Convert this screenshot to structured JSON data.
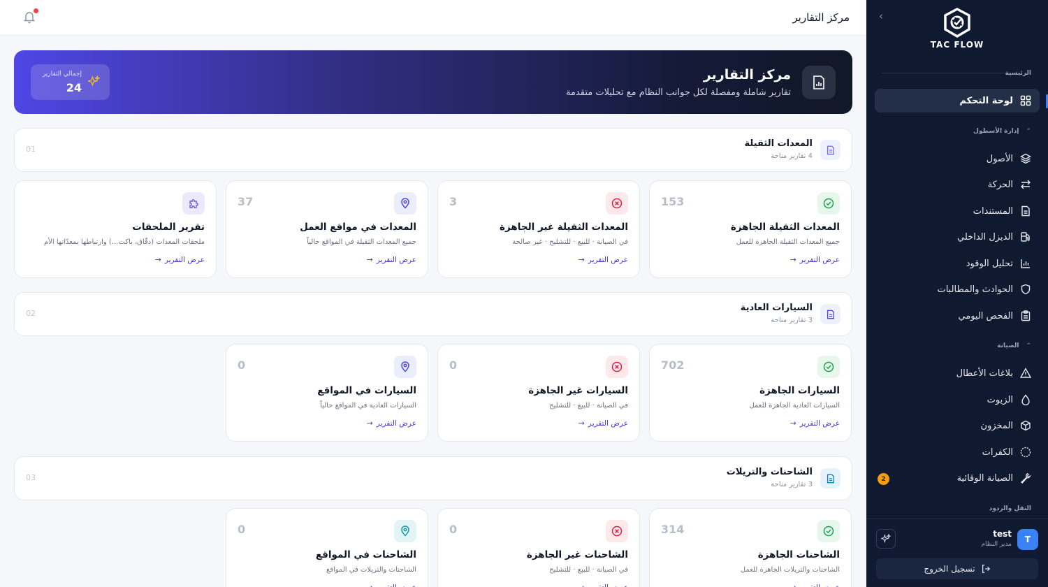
{
  "sidebar": {
    "brand": "TAC FLOW",
    "sections": {
      "main": "الرئيسية",
      "fleet": "إدارة الأسطول",
      "maintenance": "الصيانة",
      "transport": "النقل والردود"
    },
    "items": {
      "dashboard": "لوحة التحكم",
      "assets": "الأصول",
      "movement": "الحركة",
      "documents": "المستندات",
      "internal_diesel": "الديزل الداخلي",
      "fuel_analysis": "تحليل الوقود",
      "incidents": "الحوادث والمطالبات",
      "daily_inspection": "الفحص اليومي",
      "fault_reports": "بلاغات الأعطال",
      "oils": "الزيوت",
      "inventory": "المخزون",
      "tires": "الكفرات",
      "preventive": "الصيانة الوقائية"
    },
    "preventive_badge": "2",
    "user": {
      "initial": "T",
      "name": "test",
      "role": "مدير النظام"
    },
    "logout": "تسجيل الخروج"
  },
  "topbar": {
    "title": "مركز التقارير"
  },
  "hero": {
    "title": "مركز التقارير",
    "subtitle": "تقارير شاملة ومفصلة لكل جوانب النظام مع تحليلات متقدمة",
    "total_label": "إجمالي التقارير",
    "total_value": "24"
  },
  "link_label": "عرض التقرير",
  "sections": [
    {
      "title": "المعدات الثقيلة",
      "subtitle": "4 تقارير متاحة",
      "num": "01",
      "cards": [
        {
          "title": "المعدات الثقيلة الجاهزة",
          "desc": "جميع المعدات الثقيلة الجاهزة للعمل",
          "count": "153",
          "icon": "check-circle-icon"
        },
        {
          "title": "المعدات الثقيلة غير الجاهزة",
          "desc": "في الصيانة · للبيع · للتشليح · غير صالحة",
          "count": "3",
          "icon": "x-circle-icon"
        },
        {
          "title": "المعدات في مواقع العمل",
          "desc": "جميع المعدات الثقيلة في المواقع حالياً",
          "count": "37",
          "icon": "map-pin-icon"
        },
        {
          "title": "تقرير الملحقات",
          "desc": "ملحقات المعدات (دقّاق، باكت...) وارتباطها بمعدّاتها الأم",
          "count": "",
          "icon": "puzzle-icon"
        }
      ]
    },
    {
      "title": "السيارات العادية",
      "subtitle": "3 تقارير متاحة",
      "num": "02",
      "cards": [
        {
          "title": "السيارات الجاهزة",
          "desc": "السيارات العادية الجاهزة للعمل",
          "count": "702",
          "icon": "check-circle-icon"
        },
        {
          "title": "السيارات غير الجاهزة",
          "desc": "في الصيانة · للبيع · للتشليح",
          "count": "0",
          "icon": "x-circle-icon"
        },
        {
          "title": "السيارات في المواقع",
          "desc": "السيارات العادية في المواقع حالياً",
          "count": "0",
          "icon": "map-pin-icon"
        }
      ]
    },
    {
      "title": "الشاحنات والتريلات",
      "subtitle": "3 تقارير متاحة",
      "num": "03",
      "cards": [
        {
          "title": "الشاحنات الجاهزة",
          "desc": "الشاحنات والتريلات الجاهزة للعمل",
          "count": "314",
          "icon": "check-circle-icon"
        },
        {
          "title": "الشاحنات غير الجاهزة",
          "desc": "في الصيانة · للبيع · للتشليح",
          "count": "0",
          "icon": "x-circle-icon"
        },
        {
          "title": "الشاحنات في المواقع",
          "desc": "الشاحنات والتريلات في المواقع",
          "count": "0",
          "icon": "map-pin-icon"
        }
      ]
    }
  ],
  "colors": {
    "accent": "#4338ca",
    "sidebar_bg": "#0f1a30",
    "ready": "#16a34a",
    "not_ready": "#e11d48",
    "location": "#4f46e5",
    "badge": "#f59e0b"
  }
}
